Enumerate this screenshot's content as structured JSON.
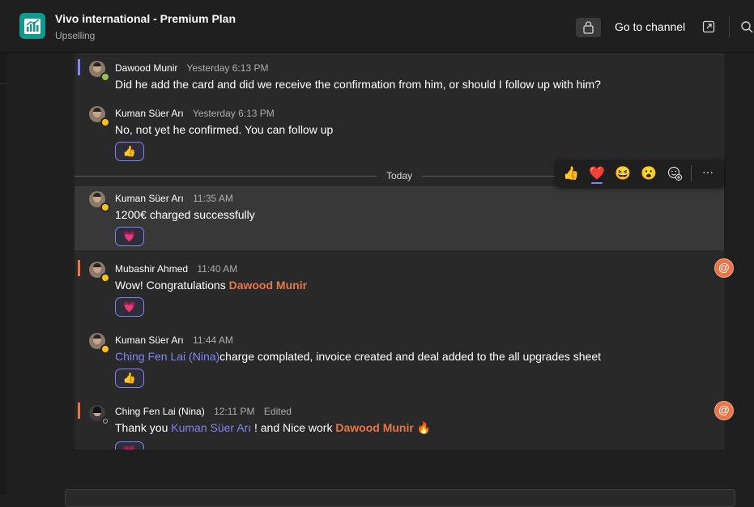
{
  "header": {
    "title": "Vivo international - Premium Plan",
    "subtitle": "Upselling",
    "go_to_channel": "Go to channel"
  },
  "divider": {
    "label": "Today"
  },
  "reaction_bar": {
    "emojis": [
      "👍",
      "❤️",
      "😆",
      "😮",
      "add-reaction"
    ],
    "selected": "❤️",
    "more": "···"
  },
  "messages": [
    {
      "author": "Dawood Munir",
      "time": "Yesterday 6:13 PM",
      "text": "Did he add the card and did we receive the confirmation from him, or should I follow up with him?",
      "presence": "available",
      "accent": "#7f85f5"
    },
    {
      "author": "Kuman Süer Arı",
      "time": "Yesterday 6:13 PM",
      "text": "No, not yet he confirmed. You can follow up",
      "presence": "away",
      "reaction": "👍"
    },
    {
      "author": "Kuman Süer Arı",
      "time": "11:35 AM",
      "text": "1200€ charged successfully",
      "presence": "away",
      "reaction": "💗"
    },
    {
      "author": "Mubashir Ahmed",
      "time": "11:40 AM",
      "text_before": "Wow! Congratulations ",
      "mention": "Dawood Munir",
      "presence": "away",
      "reaction": "💗",
      "accent": "#e97548",
      "badge": "@"
    },
    {
      "author": "Kuman Süer Arı",
      "time": "11:44 AM",
      "mention": "Ching Fen Lai (Nina)",
      "text_after": "charge complated, invoice created and deal added to the all upgrades sheet",
      "presence": "away",
      "reaction": "👍"
    },
    {
      "author": "Ching Fen Lai (Nina)",
      "time": "12:11 PM",
      "edited": "Edited",
      "text_before": "Thank you ",
      "mention1": "Kuman Süer Arı",
      "text_middle": " ! and Nice work ",
      "mention2": "Dawood Munir",
      "emoji": "🔥",
      "presence": "offline",
      "reaction": "💗",
      "accent": "#e97548",
      "badge": "@"
    }
  ],
  "colors": {
    "accent": "#7f85f5",
    "mention_me": "#e97548",
    "background": "#1f1f1f",
    "thread_bg": "#292929"
  }
}
